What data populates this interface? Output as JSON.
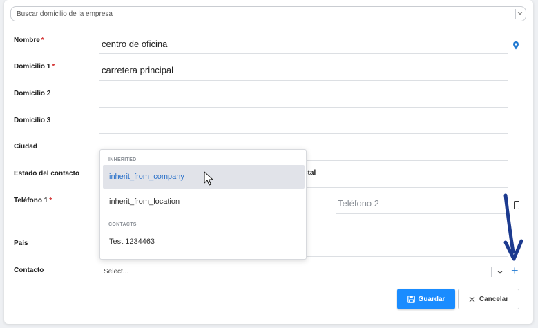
{
  "search": {
    "placeholder": "Buscar domicilio de la empresa"
  },
  "form": {
    "nombre": {
      "label": "Nombre",
      "required": "*",
      "value": "centro de oficina"
    },
    "domicilio1": {
      "label": "Domicilio 1",
      "required": "*",
      "value": "carretera principal"
    },
    "domicilio2": {
      "label": "Domicilio 2"
    },
    "domicilio3": {
      "label": "Domicilio 3"
    },
    "ciudad": {
      "label": "Ciudad"
    },
    "estado": {
      "label": "Estado del contacto"
    },
    "postal_fragment": "stal",
    "telefono1": {
      "label": "Teléfono 1",
      "required": "*"
    },
    "telefono2": {
      "placeholder": "Teléfono 2"
    },
    "pais": {
      "label": "País"
    },
    "contacto": {
      "label": "Contacto",
      "placeholder": "Select..."
    }
  },
  "dropdown": {
    "groups": [
      {
        "label": "INHERITED",
        "items": [
          "inherit_from_company",
          "inherit_from_location"
        ]
      },
      {
        "label": "CONTACTS",
        "items": [
          "Test 1234463"
        ]
      }
    ],
    "active_item": "inherit_from_company"
  },
  "buttons": {
    "save": "Guardar",
    "cancel": "Cancelar",
    "add": "+"
  },
  "icons": {
    "search_chevron": "chevron-down-icon",
    "location": "map-pin-icon",
    "phone": "phone-icon",
    "save": "floppy-disk-icon",
    "cancel": "close-icon",
    "add": "plus-icon",
    "cursor": "mouse-pointer-icon",
    "annotation": "arrow-down-icon"
  },
  "colors": {
    "accent": "#1a8cff",
    "link": "#2a71c9",
    "required": "#d32f2f",
    "annotation_arrow": "#1c3a8f"
  }
}
